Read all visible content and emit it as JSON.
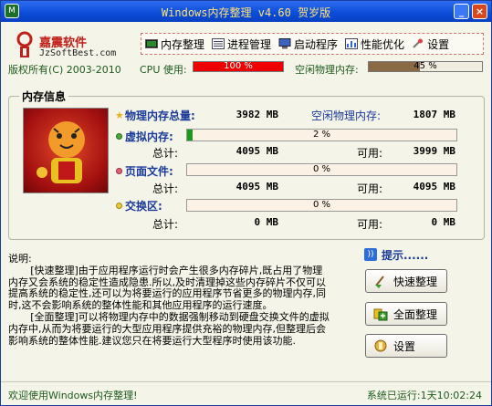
{
  "window": {
    "title": "Windows内存整理 v4.60 贺岁版"
  },
  "brand": {
    "name": "嘉震软件",
    "url": "JzSoftBest.com",
    "copyright": "版权所有(C) 2003-2010"
  },
  "menu": [
    {
      "label": "内存整理",
      "icon": "memory-chip-icon"
    },
    {
      "label": "进程管理",
      "icon": "process-list-icon"
    },
    {
      "label": "启动程序",
      "icon": "startup-computer-icon"
    },
    {
      "label": "性能优化",
      "icon": "performance-icon"
    },
    {
      "label": "设置",
      "icon": "settings-icon"
    }
  ],
  "usage": {
    "cpu_label": "CPU 使用:",
    "cpu_percent": 100,
    "cpu_text": "100 %",
    "mem_label": "空闲物理内存:",
    "mem_percent": 45,
    "mem_text": "45 %"
  },
  "meminfo": {
    "title": "内存信息",
    "physical": {
      "label": "物理内存总量:",
      "value": "3982 MB",
      "free_label": "空闲物理内存:",
      "free_value": "1807 MB"
    },
    "virtual": {
      "label": "虚拟内存:",
      "percent": 2,
      "percent_text": "2 %",
      "total_label": "总计:",
      "total": "4095 MB",
      "avail_label": "可用:",
      "avail": "3999 MB"
    },
    "pagefile": {
      "label": "页面文件:",
      "percent": 0,
      "percent_text": "0 %",
      "total_label": "总计:",
      "total": "4095 MB",
      "avail_label": "可用:",
      "avail": "4095 MB"
    },
    "swap": {
      "label": "交换区:",
      "percent": 0,
      "percent_text": "0 %",
      "total_label": "总计:",
      "total": "0 MB",
      "avail_label": "可用:",
      "avail": "0 MB"
    }
  },
  "description": {
    "title": "说明:",
    "para1": "[快速整理]由于应用程序运行时会产生很多内存碎片,既占用了物理内存又会系统的稳定性造成隐患.所以,及时清理掉这些内存碎片不仅可以提高系统的稳定性,还可以为将要运行的应用程序节省更多的物理内存,同时,这不会影响系统的整体性能和其他应用程序的运行速度。",
    "para2": "[全面整理]可以将物理内存中的数据强制移动到硬盘交换文件的虚拟内存中,从而为将要运行的大型应用程序提供充裕的物理内存,但整理后会影响系统的整体性能.建议您只在将要运行大型程序时使用该功能."
  },
  "tip": {
    "label": "提示......"
  },
  "buttons": {
    "quick": "快速整理",
    "full": "全面整理",
    "settings": "设置"
  },
  "status": {
    "welcome": "欢迎使用Windows内存整理!",
    "uptime": "系统已运行:1天10:02:24"
  }
}
